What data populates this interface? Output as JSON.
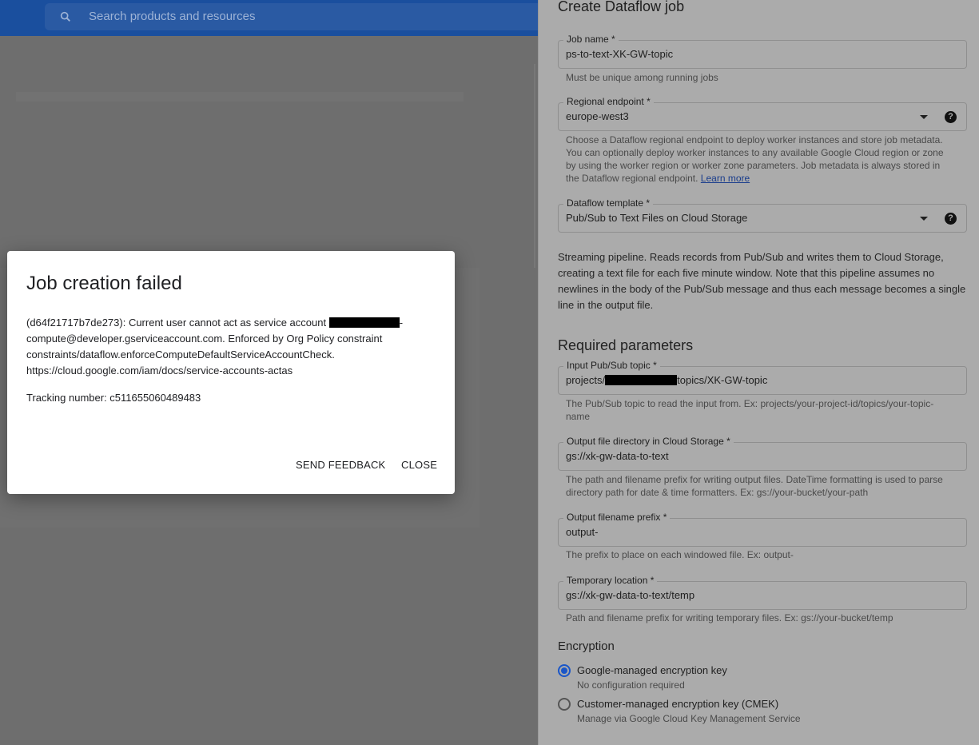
{
  "search": {
    "placeholder": "Search products and resources",
    "icon": "search-icon"
  },
  "panel": {
    "title": "Create Dataflow job",
    "job_name": {
      "label": "Job name *",
      "value": "ps-to-text-XK-GW-topic",
      "hint": "Must be unique among running jobs"
    },
    "regional_endpoint": {
      "label": "Regional endpoint *",
      "value": "europe-west3",
      "hint": "Choose a Dataflow regional endpoint to deploy worker instances and store job metadata. You can optionally deploy worker instances to any available Google Cloud region or zone by using the worker region or worker zone parameters. Job metadata is always stored in the Dataflow regional endpoint.",
      "learn_more": "Learn more"
    },
    "template": {
      "label": "Dataflow template *",
      "value": "Pub/Sub to Text Files on Cloud Storage"
    },
    "description": "Streaming pipeline. Reads records from Pub/Sub and writes them to Cloud Storage, creating a text file for each five minute window. Note that this pipeline assumes no newlines in the body of the Pub/Sub message and thus each message becomes a single line in the output file.",
    "required_title": "Required parameters",
    "pubsub_topic": {
      "label": "Input Pub/Sub topic *",
      "value_prefix": "projects/",
      "value_suffix": "topics/XK-GW-topic",
      "hint": "The Pub/Sub topic to read the input from. Ex: projects/your-project-id/topics/your-topic-name"
    },
    "output_dir": {
      "label": "Output file directory in Cloud Storage *",
      "value": "gs://xk-gw-data-to-text",
      "hint": "The path and filename prefix for writing output files. DateTime formatting is used to parse directory path for date & time formatters. Ex: gs://your-bucket/your-path"
    },
    "output_prefix": {
      "label": "Output filename prefix *",
      "value": "output-",
      "hint": "The prefix to place on each windowed file. Ex: output-"
    },
    "temp_location": {
      "label": "Temporary location *",
      "value": "gs://xk-gw-data-to-text/temp",
      "hint": "Path and filename prefix for writing temporary files. Ex: gs://your-bucket/temp"
    },
    "encryption": {
      "title": "Encryption",
      "options": [
        {
          "label": "Google-managed encryption key",
          "sub": "No configuration required",
          "selected": true
        },
        {
          "label": "Customer-managed encryption key (CMEK)",
          "sub": "Manage via Google Cloud Key Management Service",
          "selected": false
        }
      ]
    }
  },
  "dialog": {
    "title": "Job creation failed",
    "message_start": "(d64f21717b7de273): Current user cannot act as service account ",
    "message_end": "-compute@developer.gserviceaccount.com. Enforced by Org Policy constraint constraints/dataflow.enforceComputeDefaultServiceAccountCheck. https://cloud.google.com/iam/docs/service-accounts-actas",
    "tracking": "Tracking number: c511655060489483",
    "send_feedback": "SEND FEEDBACK",
    "close": "CLOSE"
  }
}
